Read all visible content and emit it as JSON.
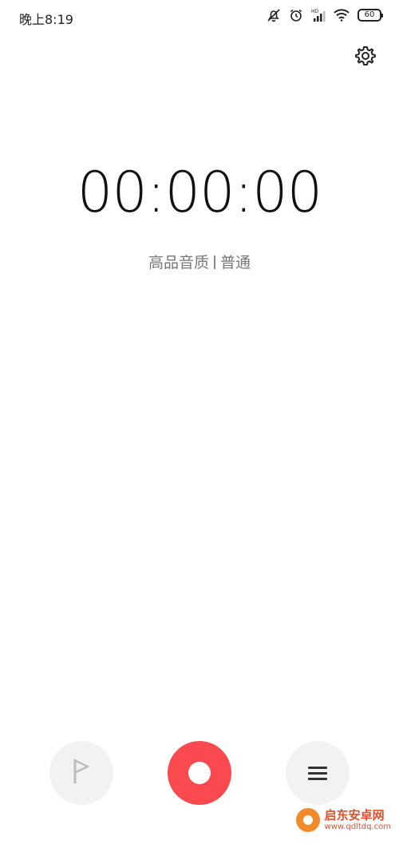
{
  "status_bar": {
    "time": "晚上8:19",
    "battery": "60",
    "icons": [
      "notifications-off-icon",
      "alarm-icon",
      "hd-signal-icon",
      "wifi-icon",
      "battery-icon"
    ]
  },
  "header": {
    "settings_icon": "gear-icon"
  },
  "recorder": {
    "elapsed": "00:00:00",
    "quality_high": "高品音质",
    "quality_normal": "普通"
  },
  "controls": {
    "mark_icon": "flag-icon",
    "record_icon": "record-icon",
    "list_icon": "menu-icon"
  },
  "watermark": {
    "title": "启东安卓网",
    "url": "www.qdltdq.com"
  },
  "colors": {
    "record": "#fa4a4f",
    "button_bg": "#f2f2f2",
    "quality_text": "#777777"
  }
}
